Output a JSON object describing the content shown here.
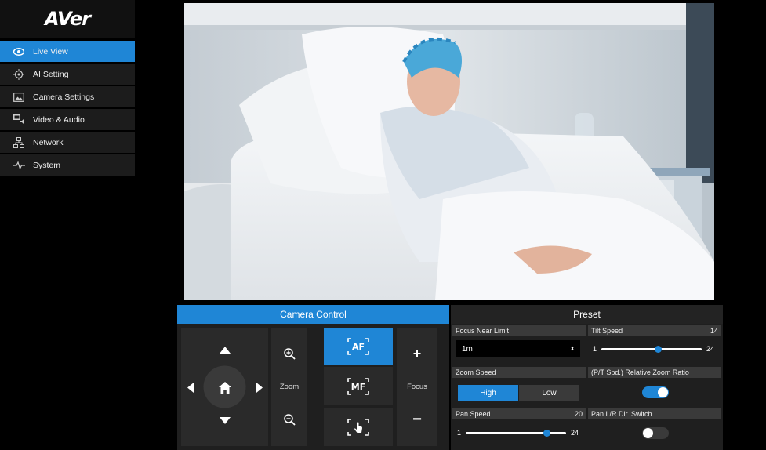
{
  "brand": {
    "logo_text": "AVer"
  },
  "sidebar": {
    "items": [
      {
        "label": "Live View",
        "icon": "eye-icon",
        "active": true
      },
      {
        "label": "AI Setting",
        "icon": "target-icon",
        "active": false
      },
      {
        "label": "Camera Settings",
        "icon": "image-icon",
        "active": false
      },
      {
        "label": "Video & Audio",
        "icon": "video-audio-icon",
        "active": false
      },
      {
        "label": "Network",
        "icon": "network-icon",
        "active": false
      },
      {
        "label": "System",
        "icon": "pulse-icon",
        "active": false
      }
    ]
  },
  "tabs": {
    "camera_control": "Camera Control",
    "preset": "Preset"
  },
  "camera_control": {
    "zoom_label": "Zoom",
    "focus_label": "Focus",
    "af_label": "AF",
    "mf_label": "MF",
    "focus_plus": "+",
    "focus_minus": "−"
  },
  "settings": {
    "focus_near_limit": {
      "label": "Focus Near Limit",
      "value": "1m"
    },
    "tilt_speed": {
      "label": "Tilt Speed",
      "value": "14",
      "min": "1",
      "max": "24",
      "fraction": 0.57
    },
    "zoom_speed": {
      "label": "Zoom Speed",
      "options": [
        "High",
        "Low"
      ],
      "selected": "High"
    },
    "relative_zoom": {
      "label": "(P/T Spd.) Relative Zoom Ratio",
      "on": true
    },
    "pan_speed": {
      "label": "Pan Speed",
      "value": "20",
      "min": "1",
      "max": "24",
      "fraction": 0.83
    },
    "pan_dir_switch": {
      "label": "Pan L/R Dir. Switch",
      "on": false
    }
  },
  "colors": {
    "accent": "#1f86d6",
    "panel": "#1f1f1f",
    "cell": "#2a2a2a"
  }
}
